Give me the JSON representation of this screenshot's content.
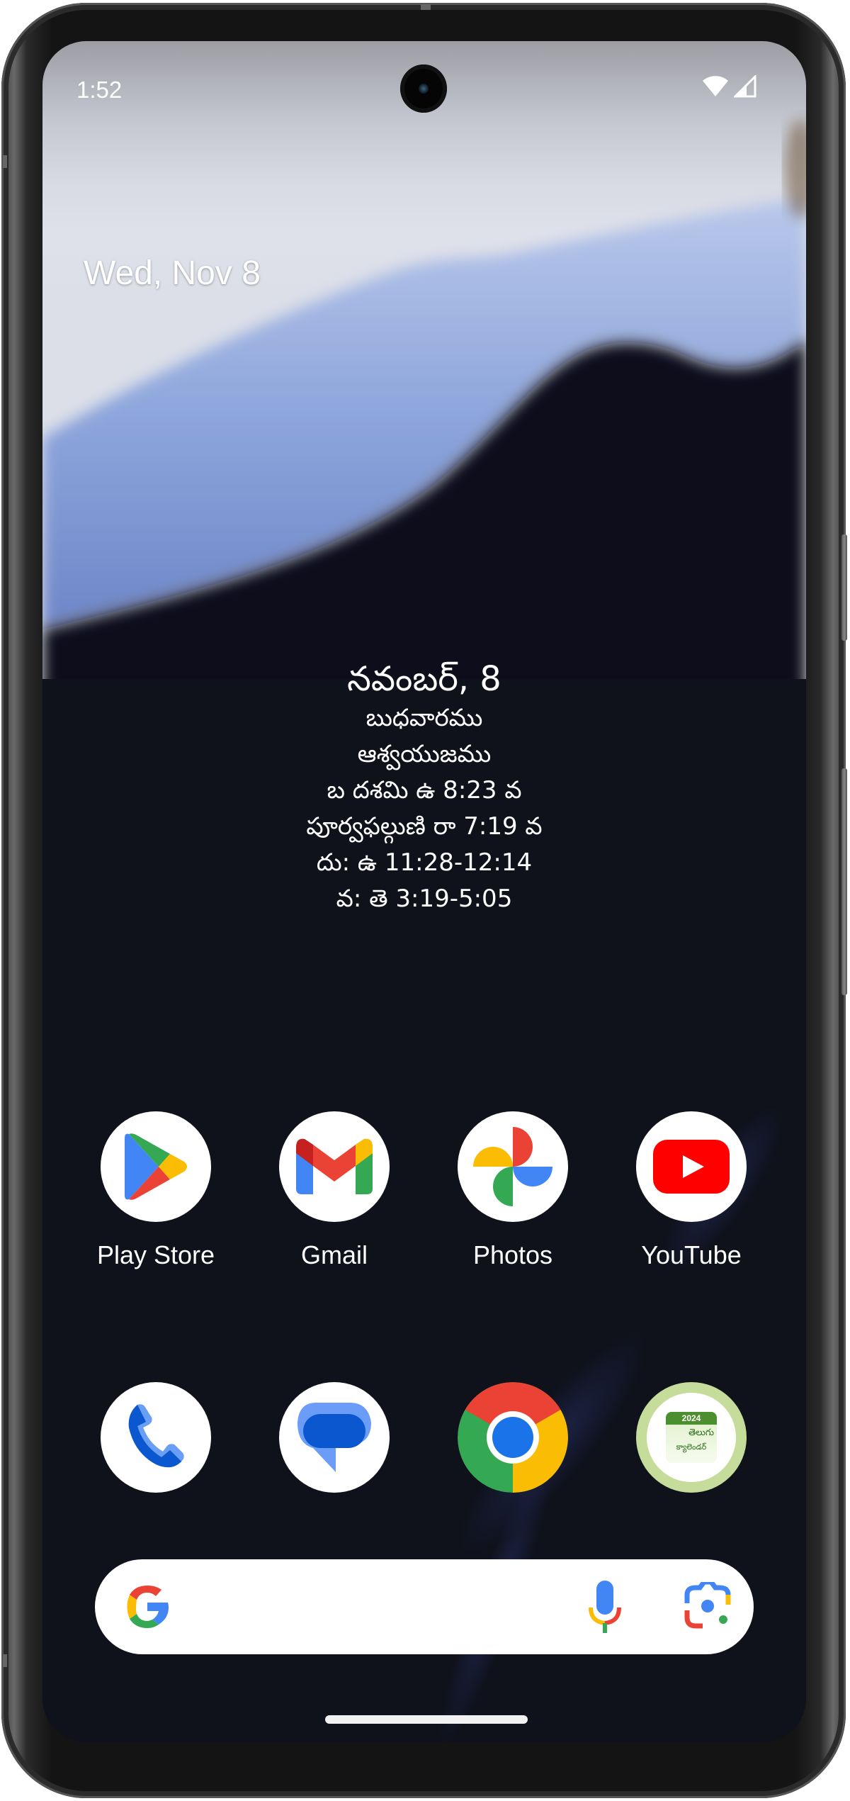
{
  "status_bar": {
    "time": "1:52",
    "icons": [
      "wifi-icon",
      "cellular-signal-icon"
    ]
  },
  "at_a_glance": {
    "date": "Wed, Nov 8"
  },
  "telugu_calendar_widget": {
    "title": "నవంబర్, 8",
    "lines": [
      "బుధవారము",
      "ఆశ్వయుజము",
      "బ దశమి ఉ 8:23 వ",
      "పూర్వఫల్గుణి రా 7:19 వ",
      "దు:  ఉ 11:28-12:14",
      "వ:  తె 3:19-5:05"
    ]
  },
  "home_apps": [
    {
      "label": "Play Store",
      "icon": "play-store-icon"
    },
    {
      "label": "Gmail",
      "icon": "gmail-icon"
    },
    {
      "label": "Photos",
      "icon": "photos-icon"
    },
    {
      "label": "YouTube",
      "icon": "youtube-icon"
    }
  ],
  "dock_apps": [
    {
      "label": "Phone",
      "icon": "phone-icon"
    },
    {
      "label": "Messages",
      "icon": "messages-icon"
    },
    {
      "label": "Chrome",
      "icon": "chrome-icon"
    },
    {
      "label": "Telugu Calendar",
      "icon": "telugu-calendar-icon",
      "badge_year": "2024",
      "badge_text_1": "తెలుగు",
      "badge_text_2": "క్యాలెండర్"
    }
  ],
  "search_bar": {
    "icons": [
      "google-g-icon",
      "microphone-icon",
      "google-lens-icon"
    ]
  },
  "colors": {
    "google_blue": "#4285F4",
    "google_red": "#EA4335",
    "google_yellow": "#FBBC04",
    "google_green": "#34A853",
    "youtube_red": "#FF0000",
    "wallpaper_dark": "#0f111b",
    "calendar_ring": "#c5dc9a",
    "calendar_green": "#4c8f2f"
  }
}
